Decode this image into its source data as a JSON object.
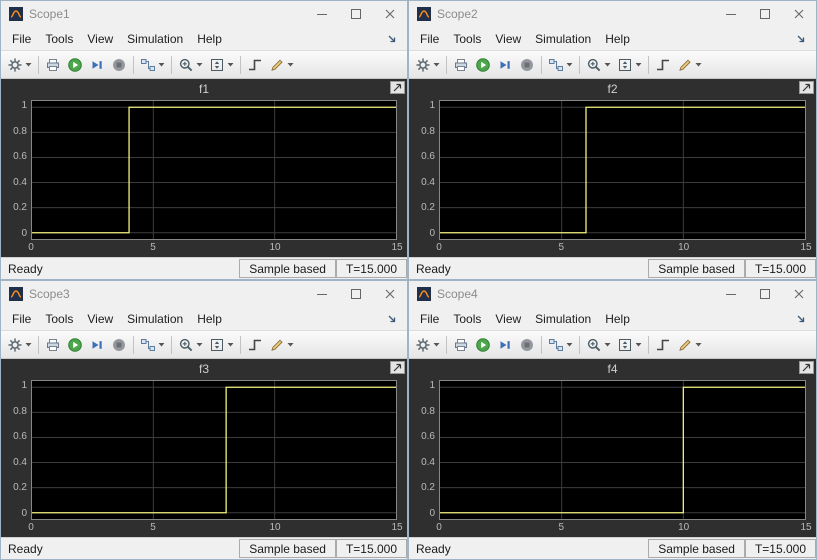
{
  "colors": {
    "trace_yellow": "#f3f17c",
    "canvas_bg": "#000000",
    "grid_line": "#3d3d3d",
    "plot_frame_bg": "#2f2f2f"
  },
  "menu": {
    "items": [
      "File",
      "Tools",
      "View",
      "Simulation",
      "Help"
    ]
  },
  "toolbar": {
    "icons": [
      "settings-gear",
      "print",
      "run",
      "step-forward",
      "stop",
      "signal-selector",
      "zoom-in",
      "fit-to-view",
      "trigger",
      "measurements"
    ]
  },
  "windows": [
    {
      "title": "Scope1",
      "plot_title": "f1",
      "status": {
        "state": "Ready",
        "sample_mode": "Sample based",
        "time": "T=15.000"
      },
      "chart": {
        "type": "line",
        "xlim": [
          0,
          15
        ],
        "ylim": [
          -0.05,
          1.05
        ],
        "x_ticks": [
          0,
          5,
          10,
          15
        ],
        "y_ticks": [
          0,
          0.2,
          0.4,
          0.6,
          0.8,
          1
        ],
        "series": [
          {
            "name": "f1",
            "step_time": 4,
            "points": [
              [
                0,
                0
              ],
              [
                4,
                0
              ],
              [
                4,
                1
              ],
              [
                15,
                1
              ]
            ]
          }
        ]
      }
    },
    {
      "title": "Scope2",
      "plot_title": "f2",
      "status": {
        "state": "Ready",
        "sample_mode": "Sample based",
        "time": "T=15.000"
      },
      "chart": {
        "type": "line",
        "xlim": [
          0,
          15
        ],
        "ylim": [
          -0.05,
          1.05
        ],
        "x_ticks": [
          0,
          5,
          10,
          15
        ],
        "y_ticks": [
          0,
          0.2,
          0.4,
          0.6,
          0.8,
          1
        ],
        "series": [
          {
            "name": "f2",
            "step_time": 6,
            "points": [
              [
                0,
                0
              ],
              [
                6,
                0
              ],
              [
                6,
                1
              ],
              [
                15,
                1
              ]
            ]
          }
        ]
      }
    },
    {
      "title": "Scope3",
      "plot_title": "f3",
      "status": {
        "state": "Ready",
        "sample_mode": "Sample based",
        "time": "T=15.000"
      },
      "chart": {
        "type": "line",
        "xlim": [
          0,
          15
        ],
        "ylim": [
          -0.05,
          1.05
        ],
        "x_ticks": [
          0,
          5,
          10,
          15
        ],
        "y_ticks": [
          0,
          0.2,
          0.4,
          0.6,
          0.8,
          1
        ],
        "series": [
          {
            "name": "f3",
            "step_time": 8,
            "points": [
              [
                0,
                0
              ],
              [
                8,
                0
              ],
              [
                8,
                1
              ],
              [
                15,
                1
              ]
            ]
          }
        ]
      }
    },
    {
      "title": "Scope4",
      "plot_title": "f4",
      "status": {
        "state": "Ready",
        "sample_mode": "Sample based",
        "time": "T=15.000"
      },
      "chart": {
        "type": "line",
        "xlim": [
          0,
          15
        ],
        "ylim": [
          -0.05,
          1.05
        ],
        "x_ticks": [
          0,
          5,
          10,
          15
        ],
        "y_ticks": [
          0,
          0.2,
          0.4,
          0.6,
          0.8,
          1
        ],
        "series": [
          {
            "name": "f4",
            "step_time": 10,
            "points": [
              [
                0,
                0
              ],
              [
                10,
                0
              ],
              [
                10,
                1
              ],
              [
                15,
                1
              ]
            ]
          }
        ]
      }
    }
  ]
}
